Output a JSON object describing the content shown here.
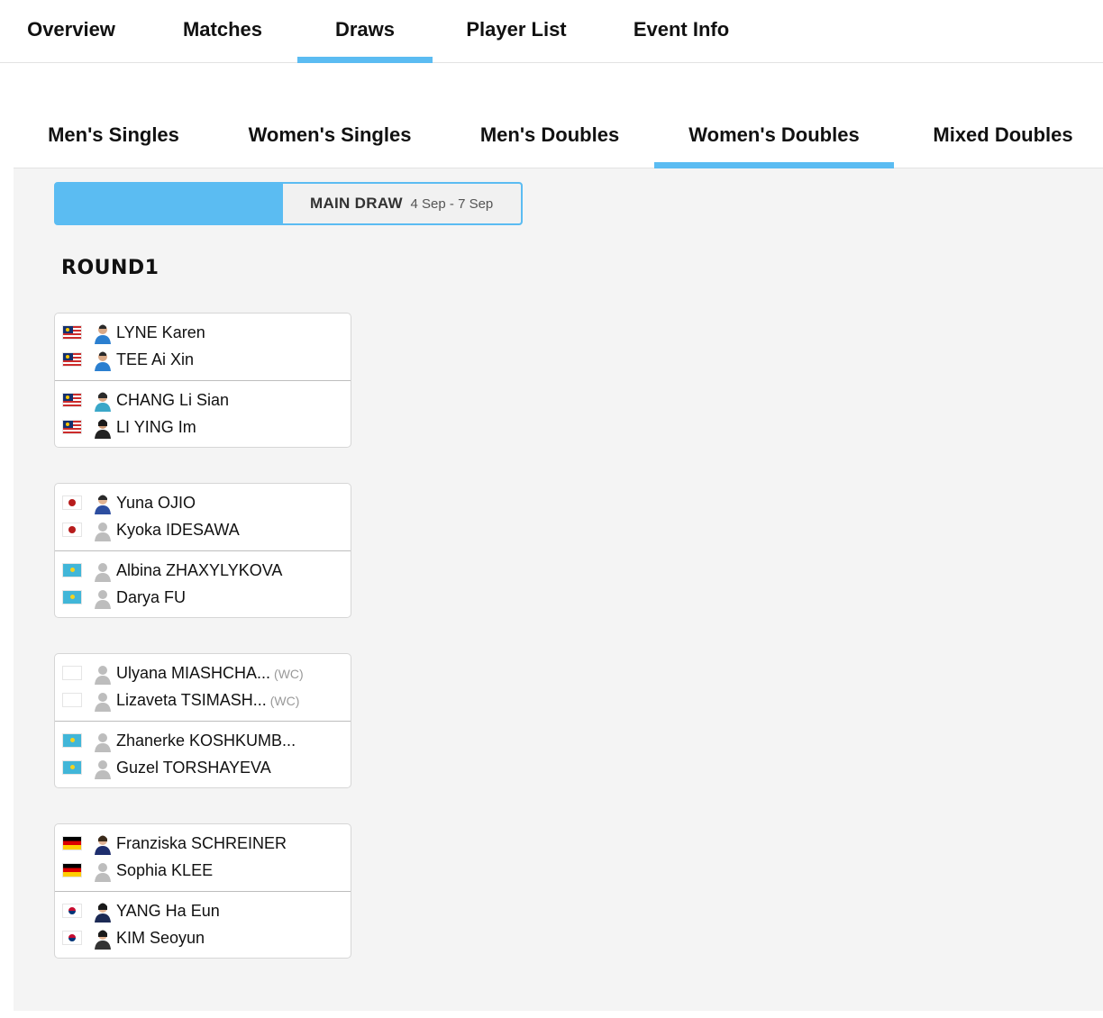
{
  "top_tabs": [
    {
      "label": "Overview"
    },
    {
      "label": "Matches"
    },
    {
      "label": "Draws",
      "active": true
    },
    {
      "label": "Player List"
    },
    {
      "label": "Event Info"
    }
  ],
  "event_tabs": [
    {
      "label": "Men's Singles"
    },
    {
      "label": "Women's Singles"
    },
    {
      "label": "Men's Doubles"
    },
    {
      "label": "Women's Doubles",
      "active": true
    },
    {
      "label": "Mixed Doubles"
    }
  ],
  "draw_toggle": {
    "main_label": "MAIN DRAW",
    "main_dates": "4 Sep - 7 Sep"
  },
  "round_title": "ROUND1",
  "matches": [
    {
      "teams": [
        {
          "players": [
            {
              "name": "LYNE Karen",
              "flag": "malaysia-flag",
              "avatar": "player-photo-icon"
            },
            {
              "name": "TEE Ai Xin",
              "flag": "malaysia-flag",
              "avatar": "player-photo-icon"
            }
          ]
        },
        {
          "players": [
            {
              "name": "CHANG Li Sian",
              "flag": "malaysia-flag",
              "avatar": "player-photo-icon"
            },
            {
              "name": "LI YING Im",
              "flag": "malaysia-flag",
              "avatar": "player-photo-icon"
            }
          ]
        }
      ]
    },
    {
      "teams": [
        {
          "players": [
            {
              "name": "Yuna OJIO",
              "flag": "japan-flag",
              "avatar": "player-photo-icon"
            },
            {
              "name": "Kyoka IDESAWA",
              "flag": "japan-flag",
              "avatar": "default-avatar-icon"
            }
          ]
        },
        {
          "players": [
            {
              "name": "Albina ZHAXYLYKOVA",
              "flag": "kazakhstan-flag",
              "avatar": "default-avatar-icon"
            },
            {
              "name": "Darya FU",
              "flag": "kazakhstan-flag",
              "avatar": "default-avatar-icon"
            }
          ]
        }
      ]
    },
    {
      "teams": [
        {
          "players": [
            {
              "name": "Ulyana MIASHCHA...",
              "note": "(WC)",
              "flag": "blank-flag",
              "avatar": "default-avatar-icon"
            },
            {
              "name": "Lizaveta TSIMASH...",
              "note": "(WC)",
              "flag": "blank-flag",
              "avatar": "default-avatar-icon"
            }
          ]
        },
        {
          "players": [
            {
              "name": "Zhanerke KOSHKUMB...",
              "flag": "kazakhstan-flag",
              "avatar": "default-avatar-icon"
            },
            {
              "name": "Guzel TORSHAYEVA",
              "flag": "kazakhstan-flag",
              "avatar": "default-avatar-icon"
            }
          ]
        }
      ]
    },
    {
      "teams": [
        {
          "players": [
            {
              "name": "Franziska SCHREINER",
              "flag": "germany-flag",
              "avatar": "player-photo-icon"
            },
            {
              "name": "Sophia KLEE",
              "flag": "germany-flag",
              "avatar": "default-avatar-icon"
            }
          ]
        },
        {
          "players": [
            {
              "name": "YANG Ha Eun",
              "flag": "korea-flag",
              "avatar": "player-photo-icon"
            },
            {
              "name": "KIM Seoyun",
              "flag": "korea-flag",
              "avatar": "player-photo-icon"
            }
          ]
        }
      ]
    }
  ],
  "colors": {
    "accent": "#5bbcf2",
    "panel_bg": "#f4f4f4",
    "text": "#111111",
    "muted": "#999999"
  }
}
